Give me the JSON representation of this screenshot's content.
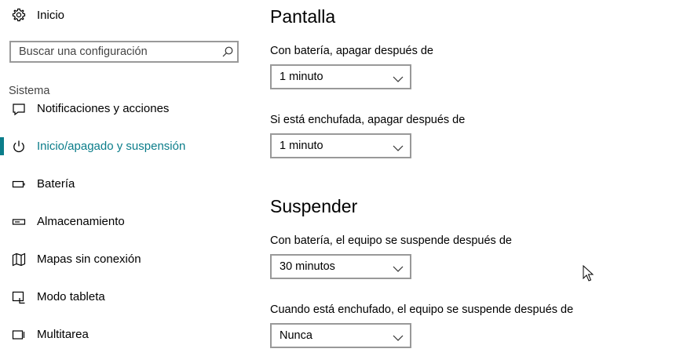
{
  "sidebar": {
    "home": {
      "label": "Inicio",
      "icon": "gear-icon"
    },
    "search": {
      "placeholder": "Buscar una configuración",
      "icon": "search-icon"
    },
    "section_label": "Sistema",
    "items": [
      {
        "label": "Notificaciones y acciones",
        "icon": "notification-icon",
        "selected": false
      },
      {
        "label": "Inicio/apagado y suspensión",
        "icon": "power-icon",
        "selected": true
      },
      {
        "label": "Batería",
        "icon": "battery-icon",
        "selected": false
      },
      {
        "label": "Almacenamiento",
        "icon": "storage-icon",
        "selected": false
      },
      {
        "label": "Mapas sin conexión",
        "icon": "map-icon",
        "selected": false
      },
      {
        "label": "Modo tableta",
        "icon": "tablet-mode-icon",
        "selected": false
      },
      {
        "label": "Multitarea",
        "icon": "multitasking-icon",
        "selected": false
      }
    ]
  },
  "main": {
    "screen": {
      "title": "Pantalla",
      "battery_label": "Con batería, apagar después de",
      "battery_value": "1 minuto",
      "plugged_label": "Si está enchufada, apagar después de",
      "plugged_value": "1 minuto"
    },
    "sleep": {
      "title": "Suspender",
      "battery_label": "Con batería, el equipo se suspende después de",
      "battery_value": "30 minutos",
      "plugged_label": "Cuando está enchufado, el equipo se suspende después de",
      "plugged_value": "Nunca"
    }
  },
  "colors": {
    "accent": "#0b7d8a",
    "border": "#999999",
    "secondary_text": "#444444"
  }
}
